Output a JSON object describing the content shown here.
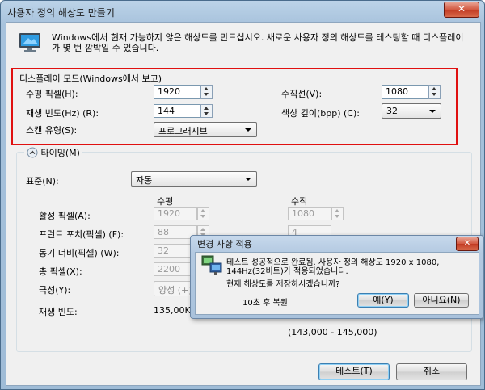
{
  "window": {
    "title": "사용자 정의 해상도 만들기",
    "close": "✕"
  },
  "intro": "Windows에서 현재 가능하지 않은 해상도를 만드십시오. 새로운 사용자 정의 해상도를 테스팅할 때 디스플레이가 몇 번 깜박일 수 있습니다.",
  "display_mode": {
    "legend": "디스플레이 모드(Windows에서 보고)",
    "h_pixels_label": "수평 픽셀(H):",
    "h_pixels_value": "1920",
    "v_lines_label": "수직선(V):",
    "v_lines_value": "1080",
    "refresh_label": "재생 빈도(Hz) (R):",
    "refresh_value": "144",
    "depth_label": "색상 깊이(bpp) (C):",
    "depth_value": "32",
    "scan_label": "스캔 유형(S):",
    "scan_value": "프로그래시브"
  },
  "timing": {
    "toggle_label": "타이밍(M)",
    "standard_label": "표준(N):",
    "standard_value": "자동",
    "col_horizontal": "수평",
    "col_vertical": "수직",
    "active_label": "활성 픽셀(A):",
    "active_h": "1920",
    "active_v": "1080",
    "front_label": "프런트 포치(픽셀) (F):",
    "front_h": "88",
    "front_v": "4",
    "sync_label": "동기 너비(픽셀) (W):",
    "sync_h": "32",
    "total_label": "총 픽셀(X):",
    "total_h": "2200",
    "polarity_label": "극성(Y):",
    "polarity_h": "양성 (+)",
    "refresh_label": "재생 빈도:",
    "refresh_h": "135,00KH",
    "range_v": "(143,000 - 145,000)"
  },
  "buttons": {
    "test": "테스트(T)",
    "cancel": "취소"
  },
  "dialog": {
    "title": "변경 사항 적용",
    "message_line1": "테스트 성공적으로 완료됨. 사용자 정의 해상도 1920 x 1080,",
    "message_line2": "144Hz(32비트)가 적용되었습니다.",
    "question": "현재 해상도를 저장하시겠습니까?",
    "countdown": "10초 후 복원",
    "yes": "예(Y)",
    "no": "아니요(N)"
  },
  "colors": {
    "highlight_border": "#e01010",
    "title_gradient": "#a7c2dc"
  }
}
